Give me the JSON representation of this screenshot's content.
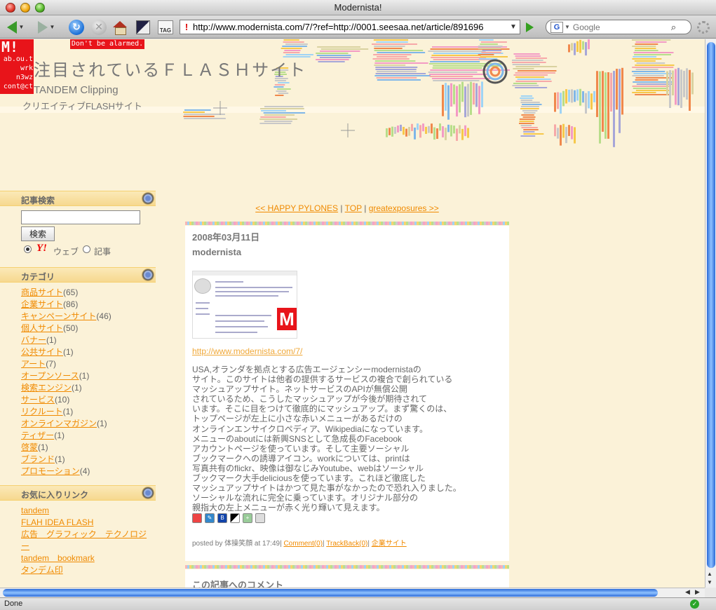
{
  "window": {
    "title": "Modernista!"
  },
  "toolbar": {
    "url": "http://www.modernista.com/7/?ref=http://0001.seesaa.net/article/891696",
    "search_placeholder": "Google",
    "search_engine_glyph": "G",
    "tag_label": "TAG"
  },
  "status": {
    "text": "Done"
  },
  "header": {
    "logo_big": "M!",
    "logo_lines": [
      "ab.ou.t",
      "wrk",
      "n3wz",
      "cont@ct"
    ],
    "alarm": "Don't be alarmed.",
    "title": "注目されているＦＬＡＳＨサイト",
    "subtitle1": "TANDEM Clipping",
    "subtitle2": "クリエイティブFLASHサイト"
  },
  "sidebar": {
    "search": {
      "heading": "記事検索",
      "button": "検索",
      "opt_web": "ウェブ",
      "opt_article": "記事",
      "yahoo": "Y!"
    },
    "categories": {
      "heading": "カテゴリ",
      "items": [
        {
          "label": "商品サイト",
          "count": "(65)"
        },
        {
          "label": "企業サイト",
          "count": "(86)"
        },
        {
          "label": "キャンペーンサイト",
          "count": "(46)"
        },
        {
          "label": "個人サイト",
          "count": "(50)"
        },
        {
          "label": "バナー",
          "count": "(1)"
        },
        {
          "label": "公共サイト",
          "count": "(1)"
        },
        {
          "label": "アート",
          "count": "(7)"
        },
        {
          "label": "オープンソース",
          "count": "(1)"
        },
        {
          "label": "検索エンジン",
          "count": "(1)"
        },
        {
          "label": "サービス",
          "count": "(10)"
        },
        {
          "label": "リクルート",
          "count": "(1)"
        },
        {
          "label": "オンラインマガジン",
          "count": "(1)"
        },
        {
          "label": "ティザー",
          "count": "(1)"
        },
        {
          "label": "啓蒙",
          "count": "(1)"
        },
        {
          "label": "ブランド",
          "count": "(1)"
        },
        {
          "label": "プロモーション",
          "count": "(4)"
        }
      ]
    },
    "favorites": {
      "heading": "お気に入りリンク",
      "items": [
        "tandem",
        "FLAH IDEA FLASH",
        "広告　グラフィック　テクノロジー",
        "tandem　bookmark",
        "タンデム印"
      ]
    }
  },
  "main": {
    "nav": {
      "prev": "<< HAPPY PYLONES",
      "sep1": "|",
      "top": "TOP",
      "sep2": "|",
      "next": "greatexposures >>"
    },
    "entry": {
      "date": "2008年03月11日",
      "title": "modernista",
      "link": "http://www.modernista.com/7/",
      "thumb_letter": "M",
      "body": [
        "USA,オランダを拠点とする広告エージェンシーmodernistaの",
        "サイト。このサイトは他者の提供するサービスの複合で創られている",
        "マッシュアップサイト。ネットサービスのAPIが無償公開",
        "されているため、こうしたマッシュアップが今後が期待されて",
        "います。そこに目をつけて徹底的にマッシュアップ。まず驚くのは、",
        "トップページが左上に小さな赤いメニューがあるだけの",
        "オンラインエンサイクロペディア、Wikipediaになっています。",
        "メニューのaboutには新興SNSとして急成長のFacebook",
        "アカウントページを使っています。そして主要ソーシャル",
        "ブックマークへの誘導アイコン。workについては、printは",
        "写真共有のflickr、映像は御なじみYoutube、webはソーシャル",
        "ブックマーク大手deliciousを使っています。これほど徹底した",
        "マッシュアップサイトはかつて見た事がなかったので恐れ入りました。",
        "ソーシャルな流れに完全に乗っています。オリジナル部分の",
        "親指大の左上メニューが赤く光り輝いて見えます。"
      ],
      "posted_prefix": "posted by 体操笑顔 at 17:49|",
      "comment": "Comment(0)",
      "sep1": "|",
      "trackback": "TrackBack(0)",
      "sep2": "|",
      "category": "企業サイト"
    },
    "comments_heading": "この記事へのコメント"
  }
}
